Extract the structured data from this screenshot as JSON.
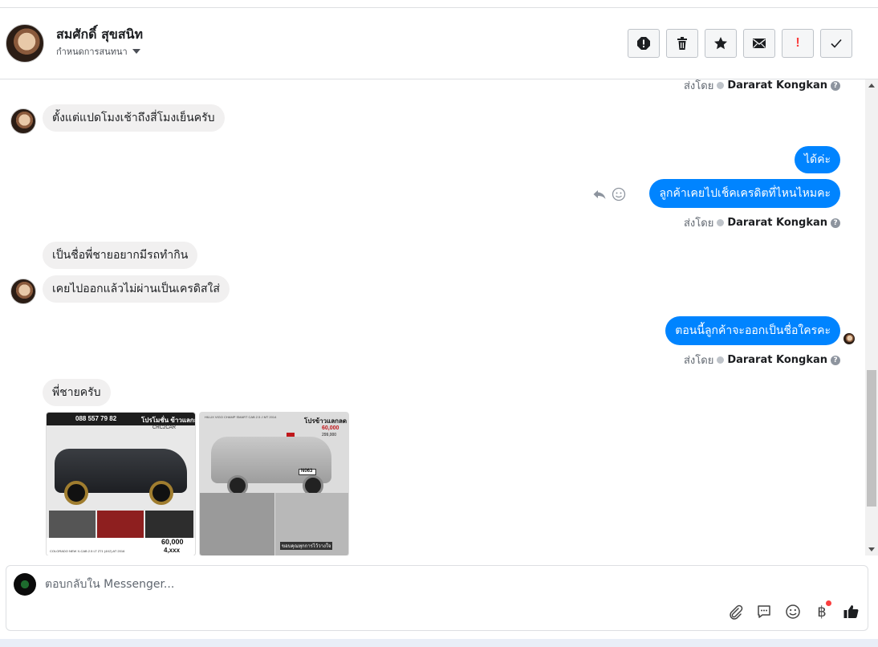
{
  "header": {
    "contact_name": "สมศักดิ์ สุขสนิท",
    "assign_label": "กำหนดการสนทนา",
    "actions": [
      {
        "name": "spam-icon"
      },
      {
        "name": "trash-icon"
      },
      {
        "name": "star-icon"
      },
      {
        "name": "mail-icon"
      },
      {
        "name": "follow-up-icon",
        "glyph": "!"
      },
      {
        "name": "done-check-icon"
      }
    ]
  },
  "messages": {
    "sentby_label": "ส่งโดย",
    "agent_name": "Dararat Kongkan",
    "m1": "ตั้งแต่แปดโมงเช้าถึงสี่โมงเย็นครับ",
    "m2": "ได้ค่ะ",
    "m3": "ลูกค้าเคยไปเช็คเครดิตที่ไหนไหมคะ",
    "m4": "เป็นชื่อพี่ชายอยากมีรถทำกิน",
    "m5": "เคยไปออกแล้วไม่ผ่านเป็นเครดิสใส่",
    "m6": "ตอนนี้ลูกค้าจะออกเป็นชื่อใครคะ",
    "m7": "พี่ชายครับ"
  },
  "photos": {
    "p1": {
      "phone": "088 557 79 82",
      "promo": "โปรโมชั่น ข้าวแลกลด",
      "model": "CRC2CAR",
      "price": "60,000",
      "monthly": "4,xxx",
      "footer": "COLORADO NEW X-CAB 2.5 LT Z71 (4X2) AT 2016"
    },
    "p2": {
      "model": "HILUX VIGO CHAMP SMART CAB 2.5 J MT 2014",
      "promo": "โปรข้าวแลกลด",
      "down": "60,000",
      "price": "299,000",
      "plate": "N063",
      "footer": "ขอบคุณทุกการไว้วางใจ"
    }
  },
  "composer": {
    "placeholder": "ตอบกลับใน Messenger..."
  },
  "colors": {
    "outgoing": "#0084ff",
    "incoming": "#f1f0f0",
    "badge": "#fa3e3e"
  }
}
